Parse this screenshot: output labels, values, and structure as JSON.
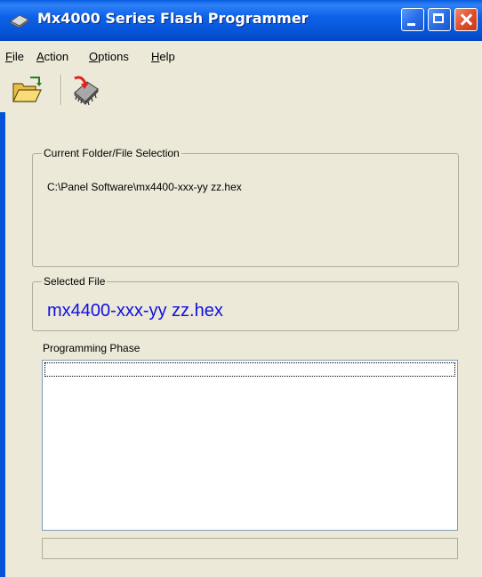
{
  "window": {
    "title": "Mx4000 Series Flash Programmer",
    "title_color": "#0553d6"
  },
  "menu": {
    "items": [
      {
        "label": "File"
      },
      {
        "label": "Action"
      },
      {
        "label": "Options"
      },
      {
        "label": "Help"
      }
    ]
  },
  "toolbar": {
    "open_icon": "open-folder-icon",
    "program_icon": "chip-program-icon"
  },
  "current_selection": {
    "legend": "Current Folder/File Selection",
    "path": "C:\\Panel Software\\mx4400-xxx-yy zz.hex"
  },
  "selected_file": {
    "legend": "Selected File",
    "name": "mx4400-xxx-yy zz.hex",
    "color": "#1010e0"
  },
  "programming_phase": {
    "label": "Programming Phase",
    "items": []
  },
  "status_bar": {
    "text": ""
  }
}
